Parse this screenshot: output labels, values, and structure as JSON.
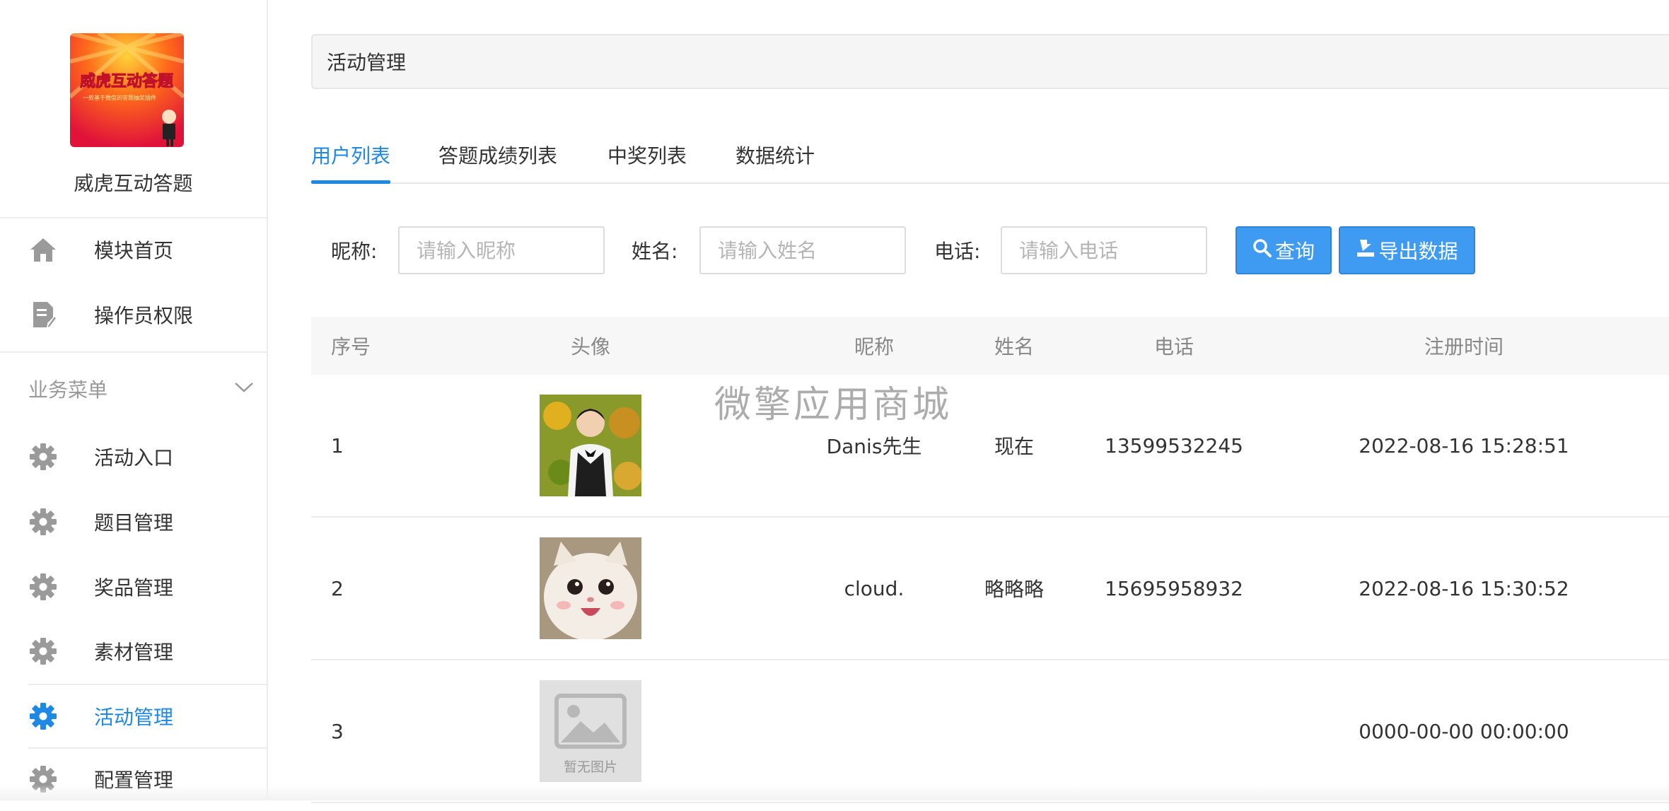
{
  "sidebar": {
    "app_name": "威虎互动答题",
    "logo": {
      "title": "威虎互动答题",
      "subtitle": "一款基于微信的答题抽奖插件"
    },
    "top_items": [
      {
        "label": "模块首页",
        "icon": "home-icon"
      },
      {
        "label": "操作员权限",
        "icon": "document-edit-icon"
      }
    ],
    "section_title": "业务菜单",
    "items": [
      {
        "label": "活动入口",
        "icon": "gear-icon",
        "active": false
      },
      {
        "label": "题目管理",
        "icon": "gear-icon",
        "active": false
      },
      {
        "label": "奖品管理",
        "icon": "gear-icon",
        "active": false
      },
      {
        "label": "素材管理",
        "icon": "gear-icon",
        "active": false
      },
      {
        "label": "活动管理",
        "icon": "gear-icon",
        "active": true
      },
      {
        "label": "配置管理",
        "icon": "gear-icon",
        "active": false
      }
    ]
  },
  "main": {
    "title": "活动管理",
    "tabs": [
      {
        "label": "用户列表",
        "active": true
      },
      {
        "label": "答题成绩列表",
        "active": false
      },
      {
        "label": "中奖列表",
        "active": false
      },
      {
        "label": "数据统计",
        "active": false
      }
    ],
    "filters": {
      "nickname_label": "昵称:",
      "nickname_placeholder": "请输入昵称",
      "name_label": "姓名:",
      "name_placeholder": "请输入姓名",
      "phone_label": "电话:",
      "phone_placeholder": "请输入电话",
      "search_label": "查询",
      "export_label": "导出数据"
    },
    "table": {
      "headers": [
        "序号",
        "头像",
        "昵称",
        "姓名",
        "电话",
        "注册时间"
      ],
      "rows": [
        {
          "index": "1",
          "avatar": "photo",
          "nickname": "Danis先生",
          "name": "现在",
          "phone": "13599532245",
          "registered": "2022-08-16 15:28:51"
        },
        {
          "index": "2",
          "avatar": "cat",
          "nickname": "cloud.",
          "name": "略略略",
          "phone": "15695958932",
          "registered": "2022-08-16 15:30:52"
        },
        {
          "index": "3",
          "avatar": "none",
          "avatar_placeholder": "暂无图片",
          "nickname": "",
          "name": "",
          "phone": "",
          "registered": "0000-00-00 00:00:00"
        }
      ]
    },
    "watermark": "微擎应用商城"
  },
  "colors": {
    "accent": "#1e88e5",
    "button": "#3f9bf1",
    "header_bg": "#f7f7f7"
  }
}
